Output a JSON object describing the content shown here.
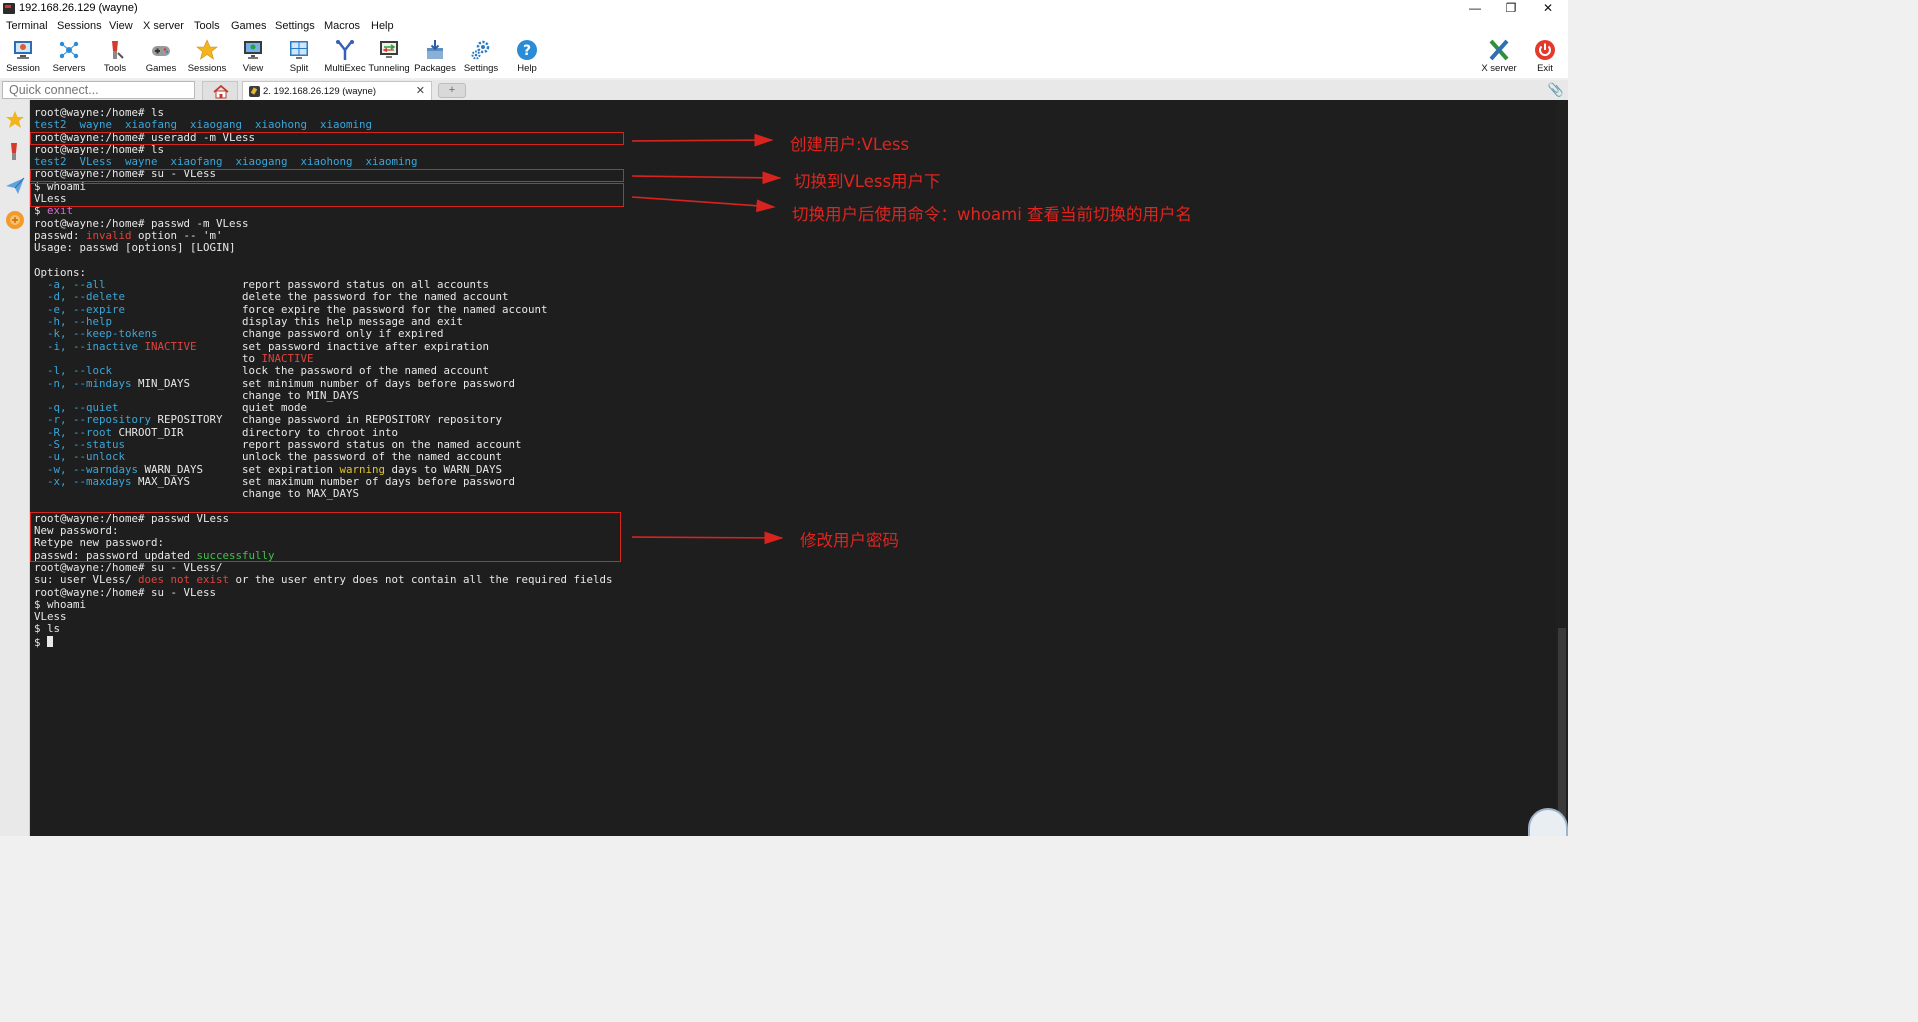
{
  "window": {
    "title": "192.168.26.129 (wayne)"
  },
  "window_controls": {
    "minimize": "—",
    "maximize": "❐",
    "close": "✕"
  },
  "menu": [
    "Terminal",
    "Sessions",
    "View",
    "X server",
    "Tools",
    "Games",
    "Settings",
    "Macros",
    "Help"
  ],
  "toolbar": [
    {
      "label": "Session",
      "icon": "session-icon"
    },
    {
      "label": "Servers",
      "icon": "servers-icon"
    },
    {
      "label": "Tools",
      "icon": "tools-icon"
    },
    {
      "label": "Games",
      "icon": "games-icon"
    },
    {
      "label": "Sessions",
      "icon": "sessions-star-icon"
    },
    {
      "label": "View",
      "icon": "view-icon"
    },
    {
      "label": "Split",
      "icon": "split-icon"
    },
    {
      "label": "MultiExec",
      "icon": "multiexec-icon"
    },
    {
      "label": "Tunneling",
      "icon": "tunneling-icon"
    },
    {
      "label": "Packages",
      "icon": "packages-icon"
    },
    {
      "label": "Settings",
      "icon": "settings-icon"
    },
    {
      "label": "Help",
      "icon": "help-icon"
    }
  ],
  "toolbar_right": [
    {
      "label": "X server",
      "icon": "xserver-icon"
    },
    {
      "label": "Exit",
      "icon": "exit-icon"
    }
  ],
  "quick_connect": {
    "placeholder": "Quick connect..."
  },
  "tabs": {
    "active": "2. 192.168.26.129 (wayne)",
    "close": "✕",
    "new_tab": "+"
  },
  "colors": {
    "terminal_bg": "#1e1e1e",
    "terminal_fg": "#e8e8e8",
    "ls_blue": "#3aa6d9",
    "error_red": "#e0443e",
    "annotation_red": "#e0241e",
    "keyword_magenta": "#d56bd6",
    "warning_yellow": "#e0c530",
    "success_green": "#41c24a"
  },
  "terminal": {
    "lines": [
      [
        {
          "t": "root@wayne:/home# ls"
        }
      ],
      [
        {
          "t": "test2  wayne  xiaofang  xiaogang  xiaohong  xiaoming",
          "c": "blue"
        }
      ],
      [
        {
          "t": "root@wayne:/home# useradd -m VLess"
        }
      ],
      [
        {
          "t": "root@wayne:/home# ls"
        }
      ],
      [
        {
          "t": "test2  VLess  wayne  xiaofang  xiaogang  xiaohong  xiaoming",
          "c": "blue"
        }
      ],
      [
        {
          "t": "root@wayne:/home# su - VLess"
        }
      ],
      [
        {
          "t": "$ whoami"
        }
      ],
      [
        {
          "t": "VLess"
        }
      ],
      [
        {
          "t": "$ "
        },
        {
          "t": "exit",
          "c": "magenta"
        }
      ],
      [
        {
          "t": "root@wayne:/home# passwd -m VLess"
        }
      ],
      [
        {
          "t": "passwd: "
        },
        {
          "t": "invalid",
          "c": "red"
        },
        {
          "t": " option -- 'm'"
        }
      ],
      [
        {
          "t": "Usage: passwd [options] [LOGIN]"
        }
      ],
      [
        {
          "t": ""
        }
      ],
      [
        {
          "t": "Options:"
        }
      ],
      [
        {
          "t": "  -a, --all",
          "c": "blue"
        },
        {
          "t": "                     report password status on all accounts"
        }
      ],
      [
        {
          "t": "  -d, --delete",
          "c": "blue"
        },
        {
          "t": "                  delete the password for the named account"
        }
      ],
      [
        {
          "t": "  -e, --expire",
          "c": "blue"
        },
        {
          "t": "                  force expire the password for the named account"
        }
      ],
      [
        {
          "t": "  -h, --help",
          "c": "blue"
        },
        {
          "t": "                    display this help message and exit"
        }
      ],
      [
        {
          "t": "  -k, --keep-tokens",
          "c": "blue"
        },
        {
          "t": "             change password only if expired"
        }
      ],
      [
        {
          "t": "  -i, --inactive",
          "c": "blue"
        },
        {
          "t": " "
        },
        {
          "t": "INACTIVE",
          "c": "red"
        },
        {
          "t": "       set password inactive after expiration"
        }
      ],
      [
        {
          "t": "                                to "
        },
        {
          "t": "INACTIVE",
          "c": "red"
        }
      ],
      [
        {
          "t": "  -l, --lock",
          "c": "blue"
        },
        {
          "t": "                    lock the password of the named account"
        }
      ],
      [
        {
          "t": "  -n, --mindays",
          "c": "blue"
        },
        {
          "t": " MIN_DAYS        set minimum number of days before password"
        }
      ],
      [
        {
          "t": "                                change to MIN_DAYS"
        }
      ],
      [
        {
          "t": "  -q, --quiet",
          "c": "blue"
        },
        {
          "t": "                   quiet mode"
        }
      ],
      [
        {
          "t": "  -r, --repository",
          "c": "blue"
        },
        {
          "t": " REPOSITORY   change password in REPOSITORY repository"
        }
      ],
      [
        {
          "t": "  -R, --root",
          "c": "blue"
        },
        {
          "t": " CHROOT_DIR         directory to chroot into"
        }
      ],
      [
        {
          "t": "  -S, --status",
          "c": "blue"
        },
        {
          "t": "                  report password status on the named account"
        }
      ],
      [
        {
          "t": "  -u, --unlock",
          "c": "blue"
        },
        {
          "t": "                  unlock the password of the named account"
        }
      ],
      [
        {
          "t": "  -w, --warndays",
          "c": "blue"
        },
        {
          "t": " WARN_DAYS      set expiration "
        },
        {
          "t": "warning",
          "c": "yellow"
        },
        {
          "t": " days to WARN_DAYS"
        }
      ],
      [
        {
          "t": "  -x, --maxdays",
          "c": "blue"
        },
        {
          "t": " MAX_DAYS        set maximum number of days before password"
        }
      ],
      [
        {
          "t": "                                change to MAX_DAYS"
        }
      ],
      [
        {
          "t": ""
        }
      ],
      [
        {
          "t": "root@wayne:/home# passwd VLess"
        }
      ],
      [
        {
          "t": "New password:"
        }
      ],
      [
        {
          "t": "Retype new password:"
        }
      ],
      [
        {
          "t": "passwd: password updated "
        },
        {
          "t": "successfully",
          "c": "green"
        }
      ],
      [
        {
          "t": "root@wayne:/home# su - VLess/"
        }
      ],
      [
        {
          "t": "su: user VLess/ "
        },
        {
          "t": "does not exist",
          "c": "red"
        },
        {
          "t": " or the user entry does not contain all the required fields"
        }
      ],
      [
        {
          "t": "root@wayne:/home# su - VLess"
        }
      ],
      [
        {
          "t": "$ whoami"
        }
      ],
      [
        {
          "t": "VLess"
        }
      ],
      [
        {
          "t": "$ ls"
        }
      ],
      [
        {
          "t": "$ "
        }
      ]
    ]
  },
  "annotations": [
    {
      "text": "创建用户:VLess"
    },
    {
      "text": "切换到VLess用户下"
    },
    {
      "text": "切换用户后使用命令：whoami  查看当前切换的用户名"
    },
    {
      "text": "修改用户密码"
    }
  ]
}
